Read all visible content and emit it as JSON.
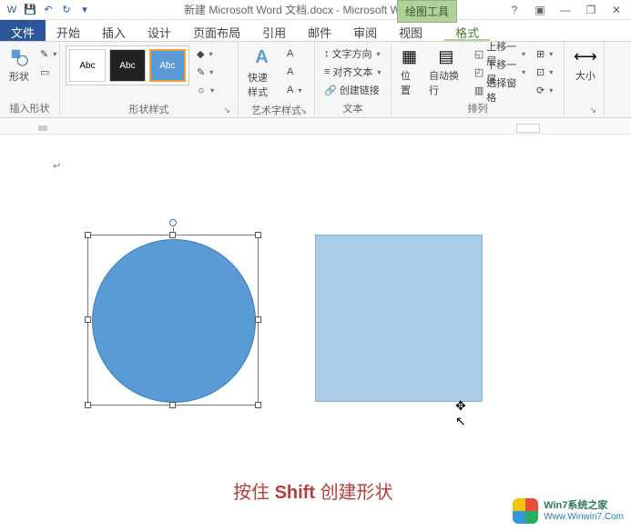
{
  "titlebar": {
    "doc_title": "新建 Microsoft Word 文档.docx - Microsoft Word",
    "contextual_tab": "绘图工具"
  },
  "qat": {
    "word": "W",
    "save": "💾",
    "undo": "↶",
    "redo": "↻",
    "more": "▾"
  },
  "window_controls": {
    "help": "?",
    "ribbon_toggle": "▣",
    "minimize": "—",
    "restore": "❐",
    "close": "✕"
  },
  "tabs": {
    "file": "文件",
    "home": "开始",
    "insert": "插入",
    "design": "设计",
    "layout": "页面布局",
    "references": "引用",
    "mailings": "邮件",
    "review": "审阅",
    "view": "视图",
    "format": "格式"
  },
  "ribbon": {
    "insert_shapes": {
      "shapes": "形状",
      "group": "插入形状"
    },
    "shape_styles": {
      "abc": "Abc",
      "group": "形状样式",
      "fill": "◆",
      "outline": "✎",
      "effects": "☼"
    },
    "wordart": {
      "quick": "快速样式",
      "group": "艺术字样式",
      "a_big": "A",
      "a_mid": "A",
      "a_small": "A"
    },
    "text": {
      "direction": "文字方向",
      "align": "对齐文本",
      "link": "创建链接",
      "group": "文本",
      "dir_icon": "↕",
      "align_icon": "≡",
      "link_icon": "🔗"
    },
    "arrange": {
      "position": "位置",
      "wrap": "自动换行",
      "forward": "上移一层",
      "backward": "下移一层",
      "pane": "选择窗格",
      "group": "排列",
      "pos_icon": "▦",
      "wrap_icon": "▤",
      "fwd_icon": "◱",
      "bwd_icon": "◰",
      "pane_icon": "▥",
      "align_icon": "⊞",
      "group_icon": "⊡",
      "rotate_icon": "⟳"
    },
    "size": {
      "label": "大小",
      "icon": "⟷"
    }
  },
  "canvas": {
    "para_mark": "↵",
    "cursor": "✥",
    "hint_pre": "按住 ",
    "hint_key": "Shift ",
    "hint_post": "创建形状",
    "colors": {
      "circle": "#5b9bd5",
      "square": "#a9cce9"
    }
  },
  "watermark": {
    "title": "Win7系统之家",
    "url": "Www.Winwin7.Com"
  }
}
